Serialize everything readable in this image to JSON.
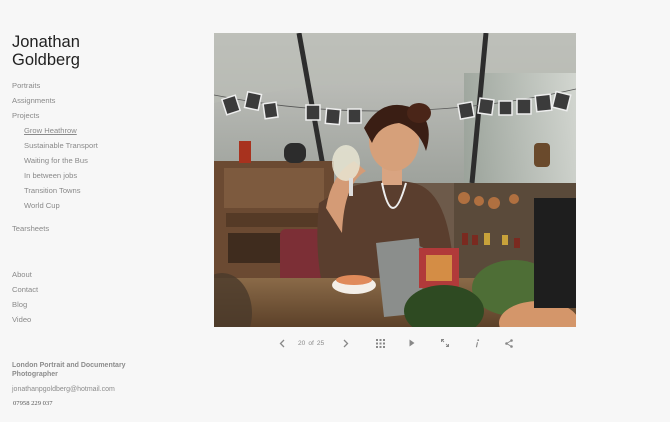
{
  "site": {
    "title": "Jonathan Goldberg"
  },
  "nav": {
    "portraits": "Portraits",
    "assignments": "Assignments",
    "projects": "Projects",
    "project_items": [
      "Grow Heathrow",
      "Sustainable Transport",
      "Waiting for the Bus",
      "In between jobs",
      "Transition Towns",
      "World Cup"
    ],
    "tearsheets": "Tearsheets",
    "about": "About",
    "contact": "Contact",
    "blog": "Blog",
    "video": "Video"
  },
  "footer": {
    "title": "London Portrait and Documentary Photographer",
    "email": "jonathanpgoldberg@hotmail.com",
    "phone": "07958 229 037"
  },
  "gallery": {
    "current": "20",
    "of_label": "of",
    "total": "25",
    "icons": [
      "chevron-left-icon",
      "chevron-right-icon",
      "grid-icon",
      "play-icon",
      "fullscreen-icon",
      "info-icon",
      "share-icon"
    ]
  },
  "colors": {
    "background": "#f7f7f7",
    "title": "#222222",
    "nav": "#8a8a8a"
  }
}
